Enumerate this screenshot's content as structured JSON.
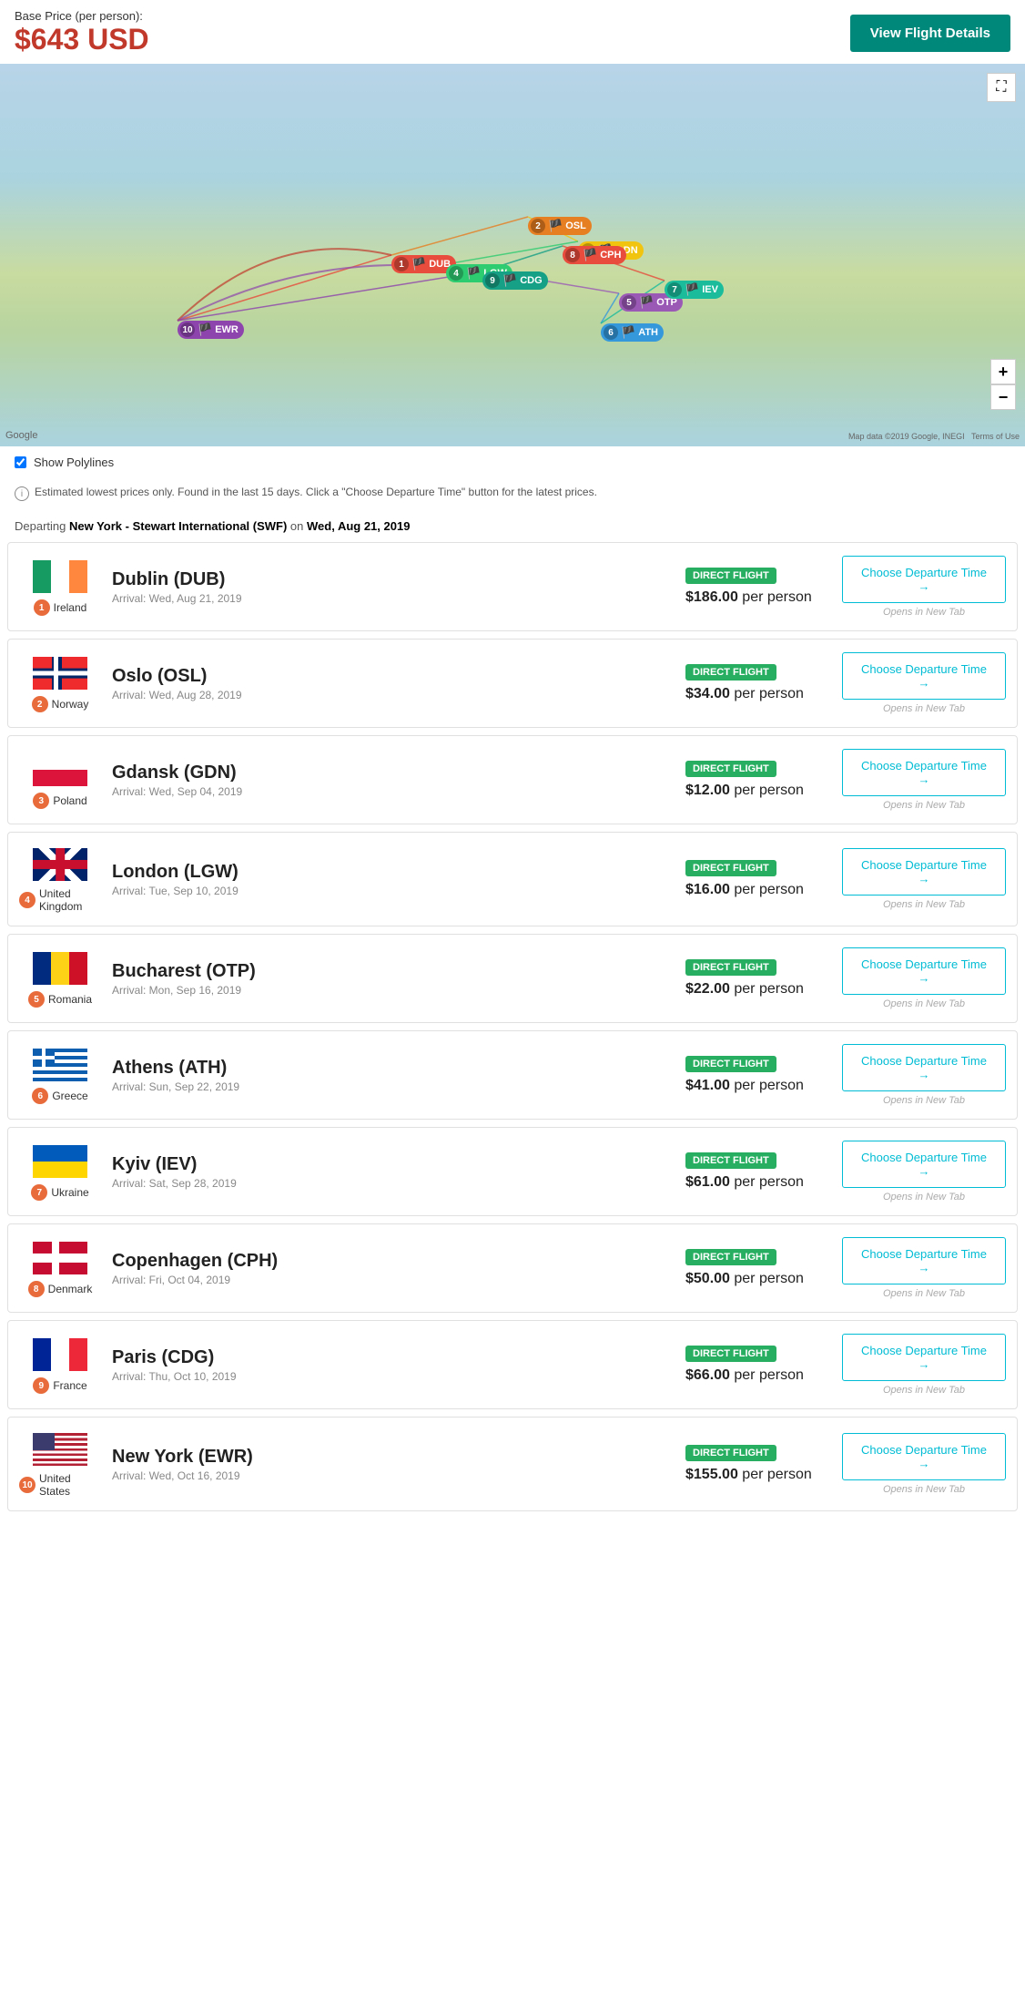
{
  "header": {
    "base_price_label": "Base Price (per person):",
    "base_price": "$643 USD",
    "view_details_btn": "View Flight Details"
  },
  "map": {
    "show_polylines_label": "Show Polylines",
    "expand_icon": "⛶",
    "zoom_in": "+",
    "zoom_out": "−",
    "logo": "Google",
    "copyright": "Map data ©2019 Google, INEGI  Terms of Use"
  },
  "info_bar": {
    "icon": "i",
    "text": "Estimated lowest prices only. Found in the last 15 days. Click a \"Choose Departure Time\" button for the latest prices."
  },
  "departing": {
    "label": "Departing New York - Stewart International (SWF) on Wed, Aug 21, 2019"
  },
  "flights": [
    {
      "num": 1,
      "country": "Ireland",
      "flag": "ireland",
      "dest_name": "Dublin (DUB)",
      "arrival": "Arrival: Wed, Aug 21, 2019",
      "badge": "DIRECT FLIGHT",
      "price": "$186.00 per person",
      "cta": "Choose Departure Time →",
      "opens": "Opens in New Tab"
    },
    {
      "num": 2,
      "country": "Norway",
      "flag": "norway",
      "dest_name": "Oslo (OSL)",
      "arrival": "Arrival: Wed, Aug 28, 2019",
      "badge": "DIRECT FLIGHT",
      "price": "$34.00 per person",
      "cta": "Choose Departure Time →",
      "opens": "Opens in New Tab"
    },
    {
      "num": 3,
      "country": "Poland",
      "flag": "poland",
      "dest_name": "Gdansk (GDN)",
      "arrival": "Arrival: Wed, Sep 04, 2019",
      "badge": "DIRECT FLIGHT",
      "price": "$12.00 per person",
      "cta": "Choose Departure Time →",
      "opens": "Opens in New Tab"
    },
    {
      "num": 4,
      "country": "United Kingdom",
      "flag": "uk",
      "dest_name": "London (LGW)",
      "arrival": "Arrival: Tue, Sep 10, 2019",
      "badge": "DIRECT FLIGHT",
      "price": "$16.00 per person",
      "cta": "Choose Departure Time →",
      "opens": "Opens in New Tab"
    },
    {
      "num": 5,
      "country": "Romania",
      "flag": "romania",
      "dest_name": "Bucharest (OTP)",
      "arrival": "Arrival: Mon, Sep 16, 2019",
      "badge": "DIRECT FLIGHT",
      "price": "$22.00 per person",
      "cta": "Choose Departure Time →",
      "opens": "Opens in New Tab"
    },
    {
      "num": 6,
      "country": "Greece",
      "flag": "greece",
      "dest_name": "Athens (ATH)",
      "arrival": "Arrival: Sun, Sep 22, 2019",
      "badge": "DIRECT FLIGHT",
      "price": "$41.00 per person",
      "cta": "Choose Departure Time →",
      "opens": "Opens in New Tab"
    },
    {
      "num": 7,
      "country": "Ukraine",
      "flag": "ukraine",
      "dest_name": "Kyiv (IEV)",
      "arrival": "Arrival: Sat, Sep 28, 2019",
      "badge": "DIRECT FLIGHT",
      "price": "$61.00 per person",
      "cta": "Choose Departure Time →",
      "opens": "Opens in New Tab"
    },
    {
      "num": 8,
      "country": "Denmark",
      "flag": "denmark",
      "dest_name": "Copenhagen (CPH)",
      "arrival": "Arrival: Fri, Oct 04, 2019",
      "badge": "DIRECT FLIGHT",
      "price": "$50.00 per person",
      "cta": "Choose Departure Time →",
      "opens": "Opens in New Tab"
    },
    {
      "num": 9,
      "country": "France",
      "flag": "france",
      "dest_name": "Paris (CDG)",
      "arrival": "Arrival: Thu, Oct 10, 2019",
      "badge": "DIRECT FLIGHT",
      "price": "$66.00 per person",
      "cta": "Choose Departure Time →",
      "opens": "Opens in New Tab"
    },
    {
      "num": 10,
      "country": "United States",
      "flag": "usa",
      "dest_name": "New York (EWR)",
      "arrival": "Arrival: Wed, Oct 16, 2019",
      "badge": "DIRECT FLIGHT",
      "price": "$155.00 per person",
      "cta": "Choose Departure Time →",
      "opens": "Opens in New Tab"
    }
  ],
  "pins": [
    {
      "num": 1,
      "label": "DUB",
      "color": "#e74c3c",
      "top": "210",
      "left": "430"
    },
    {
      "num": 2,
      "label": "OSL",
      "color": "#e67e22",
      "top": "168",
      "left": "580"
    },
    {
      "num": 3,
      "label": "GDN",
      "color": "#f1c40f",
      "top": "195",
      "left": "635"
    },
    {
      "num": 4,
      "label": "LGW",
      "color": "#2ecc71",
      "top": "220",
      "left": "490"
    },
    {
      "num": 5,
      "label": "OTP",
      "color": "#9b59b6",
      "top": "252",
      "left": "680"
    },
    {
      "num": 6,
      "label": "ATH",
      "color": "#3498db",
      "top": "285",
      "left": "660"
    },
    {
      "num": 7,
      "label": "IEV",
      "color": "#1abc9c",
      "top": "238",
      "left": "730"
    },
    {
      "num": 8,
      "label": "CPH",
      "color": "#e74c3c",
      "top": "200",
      "left": "618"
    },
    {
      "num": 9,
      "label": "CDG",
      "color": "#16a085",
      "top": "228",
      "left": "530"
    },
    {
      "num": 10,
      "label": "EWR",
      "color": "#8e44ad",
      "top": "282",
      "left": "195"
    }
  ]
}
